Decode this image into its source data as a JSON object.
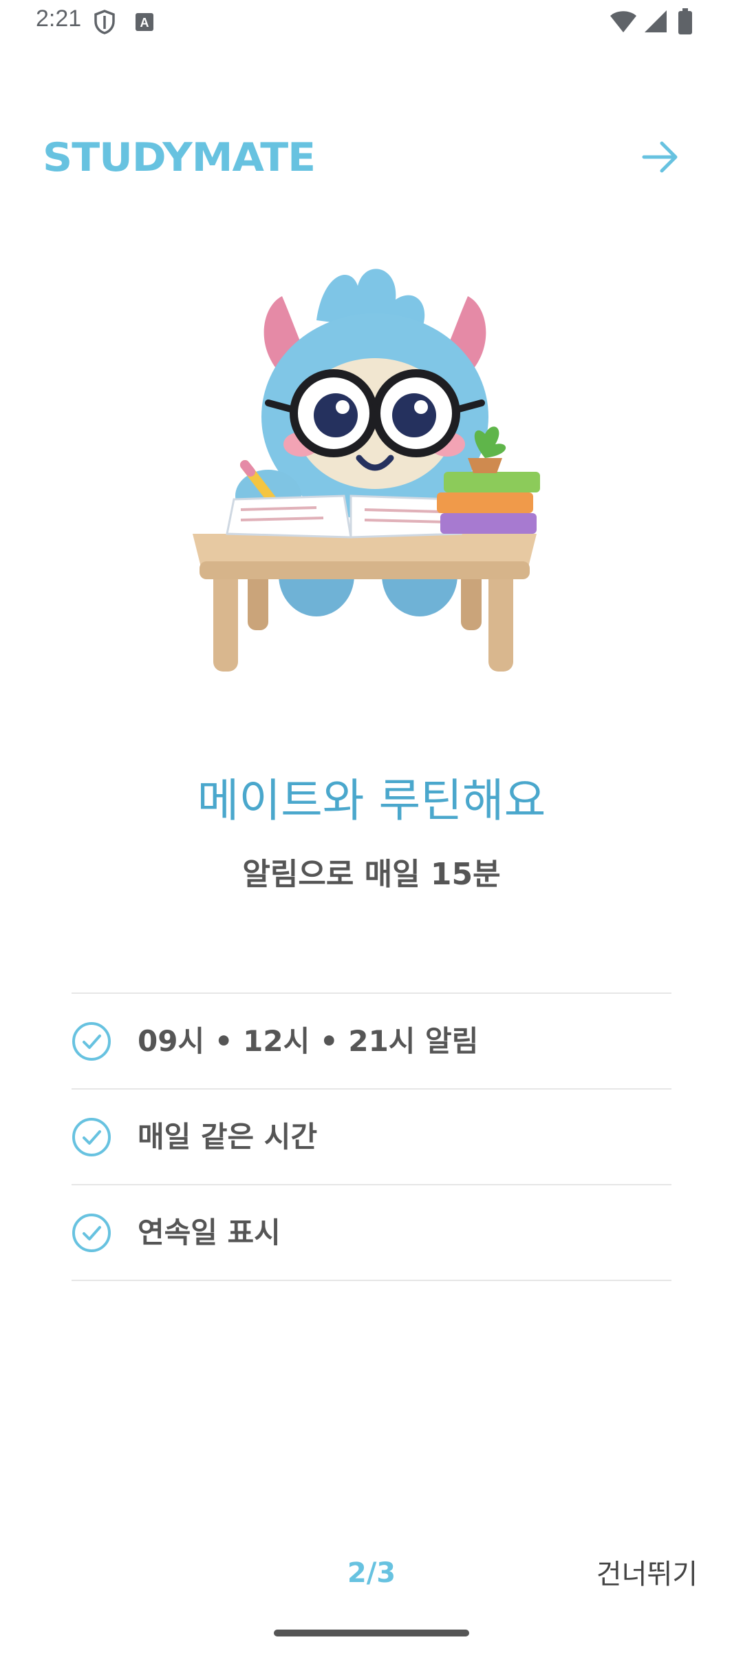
{
  "status_bar": {
    "time": "2:21"
  },
  "header": {
    "brand": "STUDYMATE",
    "next_icon": "arrow-right-icon"
  },
  "illustration": {
    "subject": "blue monster mascot with glasses studying at a desk"
  },
  "main": {
    "title": "메이트와 루틴해요",
    "subtitle": "알림으로 매일 15분"
  },
  "features": [
    {
      "label": "09시 • 12시 • 21시 알림",
      "icon": "check-circle-icon"
    },
    {
      "label": "매일 같은 시간",
      "icon": "check-circle-icon"
    },
    {
      "label": "연속일 표시",
      "icon": "check-circle-icon"
    }
  ],
  "footer": {
    "page_indicator": "2/3",
    "skip_label": "건너뛰기"
  },
  "colors": {
    "accent": "#67c2e0",
    "title": "#4aa7cc",
    "text": "#555555",
    "divider": "#e6e6e6"
  }
}
